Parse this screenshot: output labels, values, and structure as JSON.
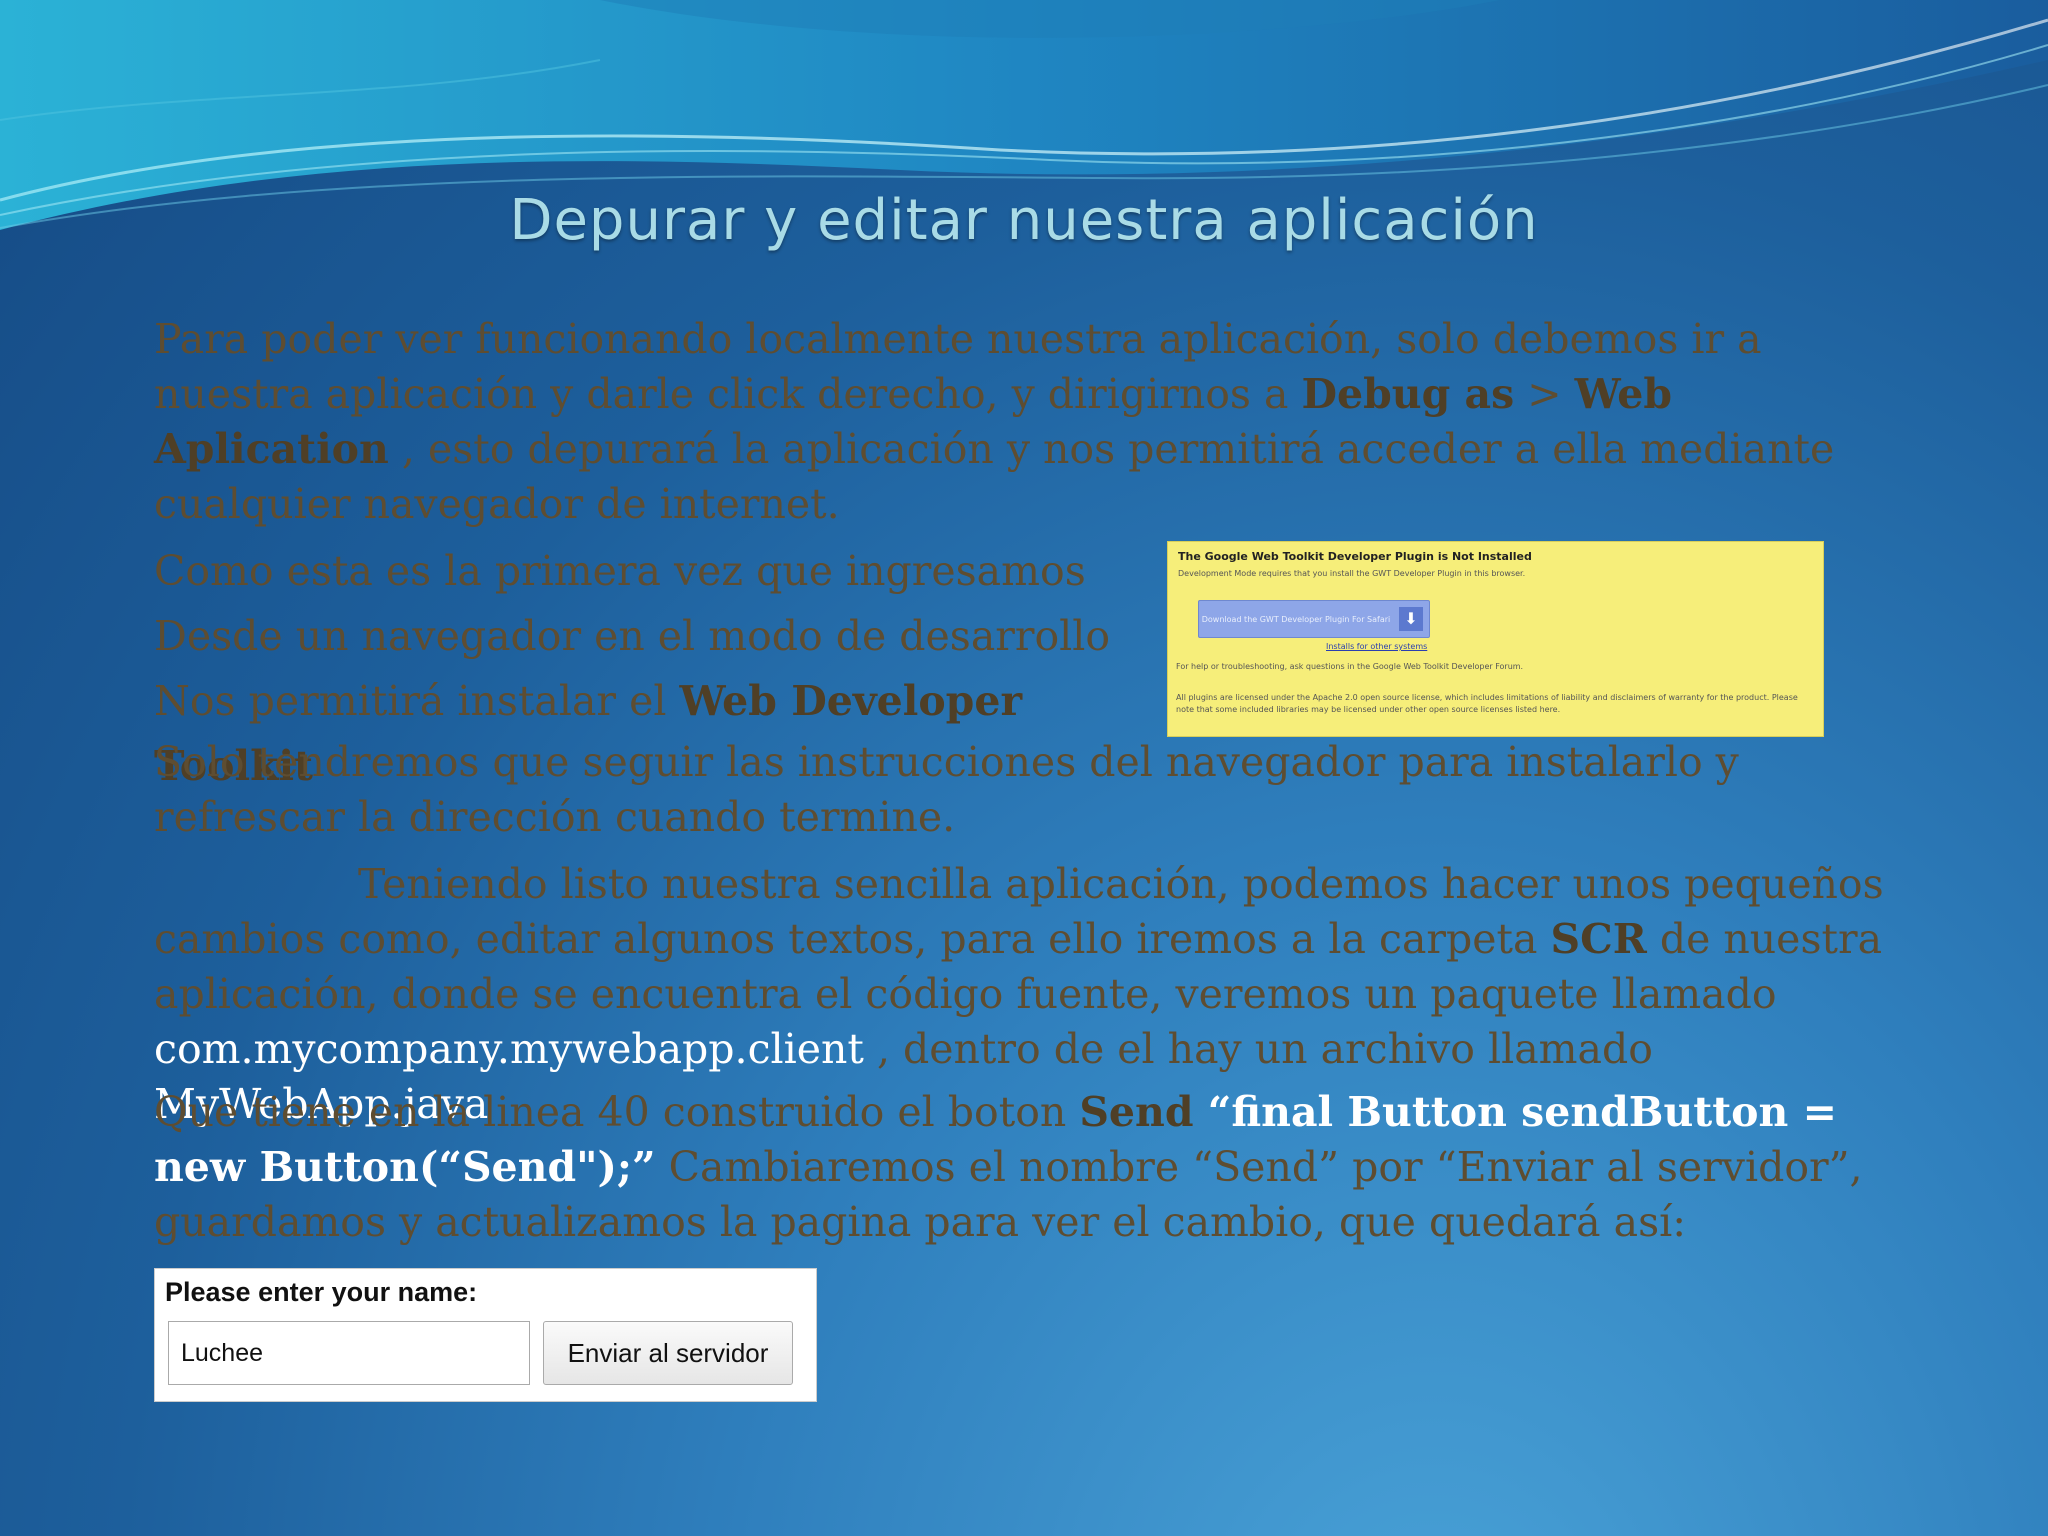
{
  "slide": {
    "title": "Depurar y editar nuestra aplicación"
  },
  "paragraph1": {
    "text_a": "Para poder ver funcionando localmente nuestra aplicación, solo debemos ir a nuestra aplicación y darle click derecho, y dirigirnos a ",
    "bold_a": "Debug as",
    "text_b": " > ",
    "bold_b": "Web Aplication",
    "text_c": " , esto depurará la aplicación y nos permitirá acceder a ella mediante cualquier navegador de internet."
  },
  "paragraph2": {
    "line1": "Como esta es la primera vez que ingresamos",
    "line2": "Desde un navegador en el modo de desarrollo",
    "line3_text": "Nos permitirá instalar el ",
    "line3_bold": "Web Developer Toolkit"
  },
  "paragraph3": {
    "text": "Solo tendremos que seguir las instrucciones del navegador para instalarlo y refrescar la dirección cuando termine."
  },
  "paragraph4": {
    "text_a": "Teniendo listo nuestra sencilla aplicación, podemos hacer unos pequeños cambios como, editar algunos textos, para ello iremos a la carpeta ",
    "bold_a": "SCR",
    "text_b": " de nuestra aplicación, donde se encuentra el código fuente, veremos un paquete llamado ",
    "package": "com.mycompany.mywebapp.client",
    "text_c": " , dentro de el hay un archivo llamado ",
    "file": "MyWebApp.java"
  },
  "paragraph5": {
    "text_a": "Que tiene en la linea 40 construido el boton ",
    "bold_a": "Send",
    "code": " “final Button sendButton = new Button(“Send\");”",
    "text_b": " Cambiaremos el nombre “Send” por “Enviar al servidor”, guardamos y actualizamos la pagina para ver el cambio, que quedará así:"
  },
  "plugin_screenshot": {
    "title": "The Google Web Toolkit Developer Plugin is Not Installed",
    "subtitle": "Development Mode requires that you install the GWT Developer Plugin in this browser.",
    "download_label": "Download the GWT Developer Plugin For Safari",
    "other_systems_link": "Installs for other systems",
    "help_text": "For help or troubleshooting, ask questions in the Google Web Toolkit Developer Forum.",
    "license_text": "All plugins are licensed under the Apache 2.0 open source license, which includes limitations of liability and disclaimers of warranty for the product. Please note that some included libraries may be licensed under other open source licenses listed here."
  },
  "form_screenshot": {
    "label": "Please enter your name:",
    "input_value": "Luchee",
    "button_label": "Enviar al servidor"
  }
}
